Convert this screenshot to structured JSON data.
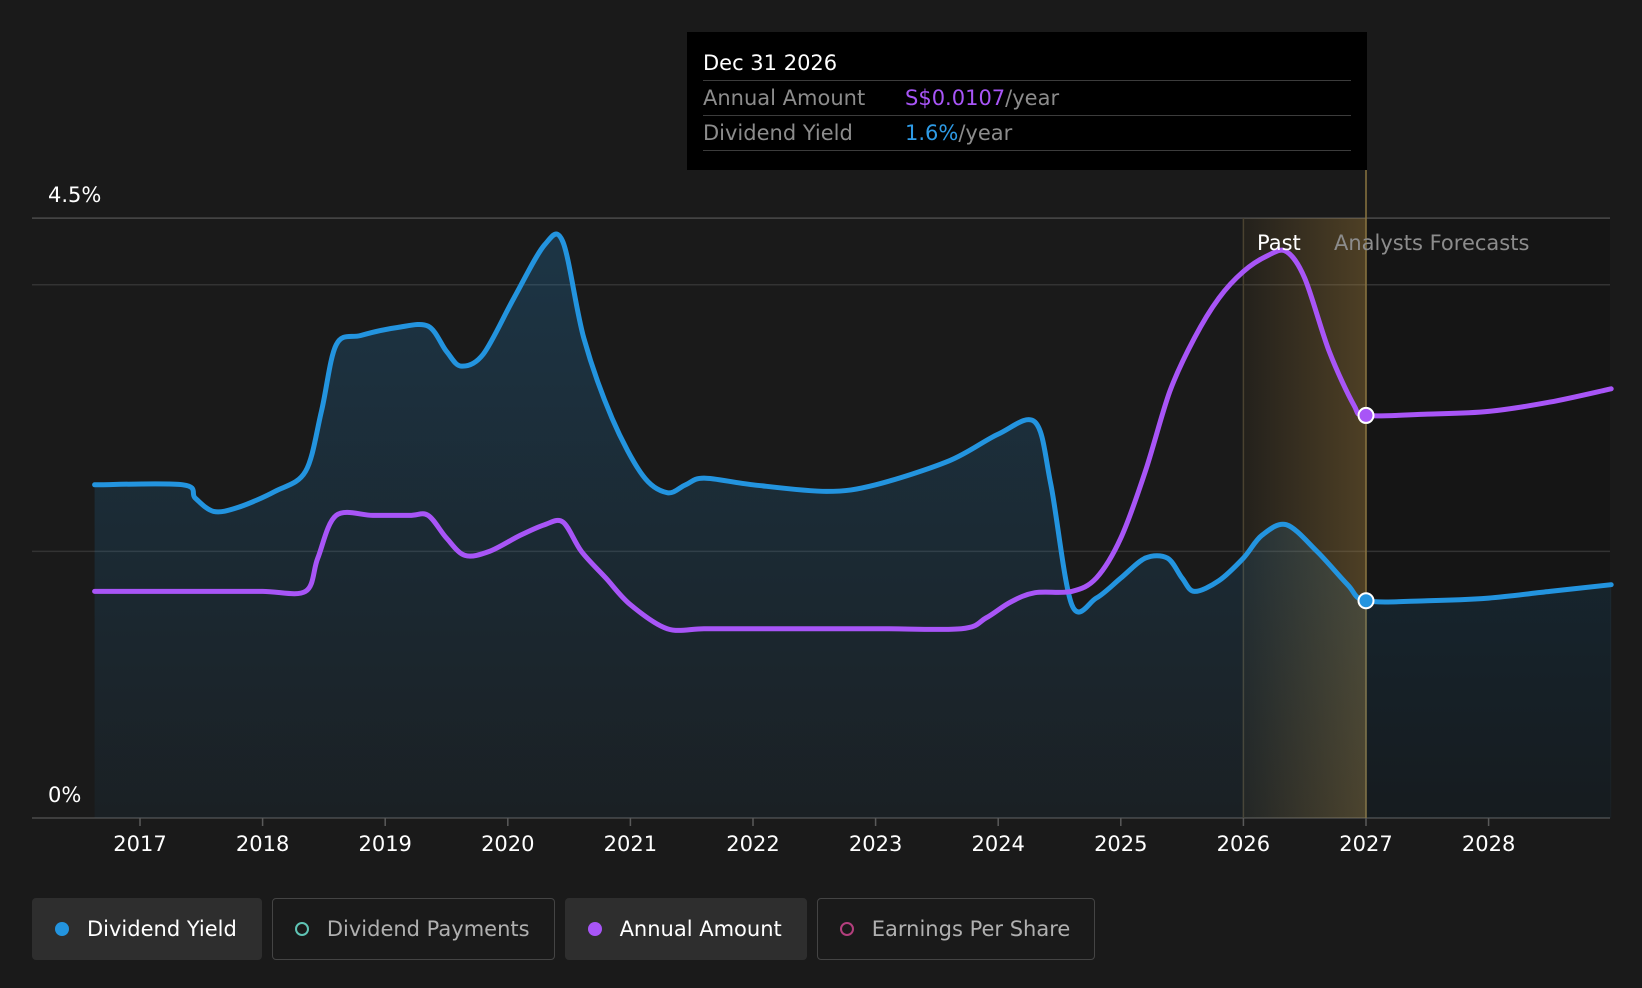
{
  "tooltip": {
    "date": "Dec 31 2026",
    "rows": [
      {
        "label": "Annual Amount",
        "value": "S$0.0107",
        "unit": "/year",
        "color": "#a855f7"
      },
      {
        "label": "Dividend Yield",
        "value": "1.6%",
        "unit": "/year",
        "color": "#2e9be6"
      }
    ]
  },
  "regions": {
    "past": "Past",
    "forecast": "Analysts Forecasts"
  },
  "legend": [
    {
      "label": "Dividend Yield",
      "color": "#2394df",
      "filled": true,
      "active": true
    },
    {
      "label": "Dividend Payments",
      "color": "#5fc4b5",
      "filled": false,
      "active": false
    },
    {
      "label": "Annual Amount",
      "color": "#a855f7",
      "filled": true,
      "active": true
    },
    {
      "label": "Earnings Per Share",
      "color": "#b33f7d",
      "filled": false,
      "active": false
    }
  ],
  "colors": {
    "background": "#1a1a1a",
    "yield": "#2394df",
    "amount": "#a855f7",
    "grid": "#3a3a3a"
  },
  "chart_data": {
    "type": "line",
    "x_axis": {
      "min": 2016.5,
      "max": 2029.0,
      "ticks": [
        "2017",
        "2018",
        "2019",
        "2020",
        "2021",
        "2022",
        "2023",
        "2024",
        "2025",
        "2026",
        "2027",
        "2028"
      ]
    },
    "y_axis": {
      "min": 0,
      "max": 4.5,
      "labels": [
        "0%",
        "4.5%"
      ],
      "gridlines": [
        0,
        2,
        4,
        4.5
      ]
    },
    "past_end": 2026.0,
    "forecast_start": 2027.0,
    "series": [
      {
        "name": "Dividend Yield",
        "color": "#2394df",
        "area": true,
        "points": [
          [
            2016.63,
            2.5
          ],
          [
            2017.35,
            2.5
          ],
          [
            2017.45,
            2.4
          ],
          [
            2017.6,
            2.3
          ],
          [
            2017.8,
            2.33
          ],
          [
            2018.1,
            2.45
          ],
          [
            2018.35,
            2.6
          ],
          [
            2018.48,
            3.05
          ],
          [
            2018.6,
            3.55
          ],
          [
            2018.8,
            3.62
          ],
          [
            2019.1,
            3.68
          ],
          [
            2019.35,
            3.69
          ],
          [
            2019.5,
            3.5
          ],
          [
            2019.62,
            3.39
          ],
          [
            2019.8,
            3.48
          ],
          [
            2020.05,
            3.9
          ],
          [
            2020.3,
            4.3
          ],
          [
            2020.45,
            4.32
          ],
          [
            2020.62,
            3.6
          ],
          [
            2020.85,
            3.0
          ],
          [
            2021.1,
            2.57
          ],
          [
            2021.3,
            2.44
          ],
          [
            2021.45,
            2.5
          ],
          [
            2021.6,
            2.55
          ],
          [
            2022.0,
            2.5
          ],
          [
            2022.6,
            2.45
          ],
          [
            2023.0,
            2.5
          ],
          [
            2023.6,
            2.68
          ],
          [
            2024.0,
            2.88
          ],
          [
            2024.3,
            2.97
          ],
          [
            2024.43,
            2.5
          ],
          [
            2024.6,
            1.6
          ],
          [
            2024.8,
            1.65
          ],
          [
            2025.0,
            1.8
          ],
          [
            2025.2,
            1.95
          ],
          [
            2025.38,
            1.95
          ],
          [
            2025.5,
            1.8
          ],
          [
            2025.6,
            1.7
          ],
          [
            2025.8,
            1.78
          ],
          [
            2026.0,
            1.95
          ],
          [
            2026.15,
            2.12
          ],
          [
            2026.35,
            2.2
          ],
          [
            2026.6,
            2.0
          ],
          [
            2026.85,
            1.75
          ],
          [
            2027.0,
            1.63
          ],
          [
            2027.5,
            1.63
          ],
          [
            2028.0,
            1.65
          ],
          [
            2028.5,
            1.7
          ],
          [
            2029.0,
            1.75
          ]
        ]
      },
      {
        "name": "Annual Amount",
        "color": "#a855f7",
        "area": false,
        "points": [
          [
            2016.63,
            1.7
          ],
          [
            2017.5,
            1.7
          ],
          [
            2018.0,
            1.7
          ],
          [
            2018.35,
            1.7
          ],
          [
            2018.45,
            1.95
          ],
          [
            2018.6,
            2.27
          ],
          [
            2018.9,
            2.27
          ],
          [
            2019.2,
            2.27
          ],
          [
            2019.35,
            2.27
          ],
          [
            2019.5,
            2.1
          ],
          [
            2019.65,
            1.97
          ],
          [
            2019.85,
            2.0
          ],
          [
            2020.1,
            2.12
          ],
          [
            2020.3,
            2.2
          ],
          [
            2020.45,
            2.22
          ],
          [
            2020.6,
            2.0
          ],
          [
            2020.8,
            1.8
          ],
          [
            2021.0,
            1.6
          ],
          [
            2021.3,
            1.42
          ],
          [
            2021.6,
            1.42
          ],
          [
            2022.0,
            1.42
          ],
          [
            2023.0,
            1.42
          ],
          [
            2023.7,
            1.42
          ],
          [
            2023.9,
            1.5
          ],
          [
            2024.1,
            1.62
          ],
          [
            2024.3,
            1.69
          ],
          [
            2024.6,
            1.7
          ],
          [
            2024.8,
            1.8
          ],
          [
            2025.0,
            2.1
          ],
          [
            2025.2,
            2.6
          ],
          [
            2025.4,
            3.2
          ],
          [
            2025.6,
            3.6
          ],
          [
            2025.8,
            3.9
          ],
          [
            2026.0,
            4.1
          ],
          [
            2026.2,
            4.22
          ],
          [
            2026.35,
            4.25
          ],
          [
            2026.5,
            4.05
          ],
          [
            2026.7,
            3.5
          ],
          [
            2026.9,
            3.1
          ],
          [
            2027.0,
            3.02
          ],
          [
            2027.5,
            3.03
          ],
          [
            2028.0,
            3.05
          ],
          [
            2028.5,
            3.12
          ],
          [
            2029.0,
            3.22
          ]
        ]
      }
    ],
    "markers": [
      {
        "series": "Annual Amount",
        "x": 2027.0,
        "y": 3.02
      },
      {
        "series": "Dividend Yield",
        "x": 2027.0,
        "y": 1.63
      }
    ]
  }
}
